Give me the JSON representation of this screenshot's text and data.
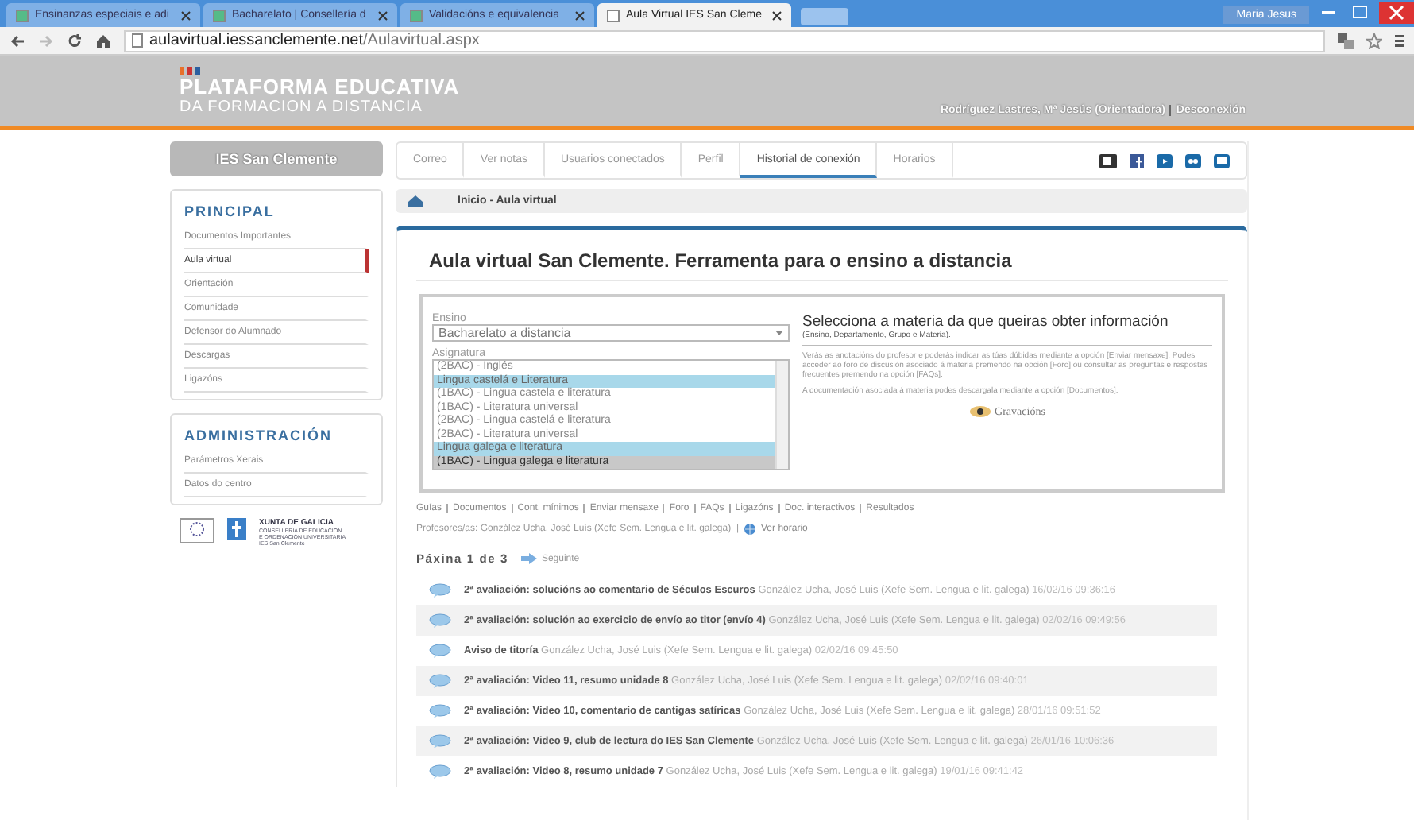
{
  "browser": {
    "tabs": [
      {
        "label": "Ensinanzas especiais e adi",
        "selected": false
      },
      {
        "label": "Bacharelato | Consellería d",
        "selected": false
      },
      {
        "label": "Validacións e equivalencia",
        "selected": false
      },
      {
        "label": "Aula Virtual IES San Cleme",
        "selected": true
      }
    ],
    "user": "Maria Jesus",
    "url_host": "aulavirtual.iessanclemente.net",
    "url_path": "/Aulavirtual.aspx"
  },
  "header": {
    "title": "PLATAFORMA EDUCATIVA",
    "subtitle": "DA FORMACION A DISTANCIA",
    "user": "Rodríguez Lastres, Mª Jesús (Orientadora)",
    "logout": "Desconexión"
  },
  "sidebar": {
    "school": "IES San Clemente",
    "sections": [
      {
        "title": "PRINCIPAL",
        "items": [
          {
            "label": "Documentos Importantes",
            "selected": false
          },
          {
            "label": "Aula virtual",
            "selected": true
          },
          {
            "label": "Orientación",
            "selected": false
          },
          {
            "label": "Comunidade",
            "selected": false
          },
          {
            "label": "Defensor do Alumnado",
            "selected": false
          },
          {
            "label": "Descargas",
            "selected": false
          },
          {
            "label": "Ligazóns",
            "selected": false
          }
        ]
      },
      {
        "title": "ADMINISTRACIÓN",
        "items": [
          {
            "label": "Parámetros Xerais",
            "selected": false
          },
          {
            "label": "Datos do centro",
            "selected": false
          }
        ]
      }
    ],
    "logo_title": "XUNTA DE GALICIA",
    "logo_lines": [
      "CONSELLERÍA DE EDUCACIÓN",
      "E ORDENACIÓN UNIVERSITARIA",
      "IES San Clemente"
    ]
  },
  "nav": {
    "tabs": [
      {
        "label": "Correo",
        "selected": false
      },
      {
        "label": "Ver notas",
        "selected": false
      },
      {
        "label": "Usuarios conectados",
        "selected": false
      },
      {
        "label": "Perfil",
        "selected": false
      },
      {
        "label": "Historial de conexión",
        "selected": true
      },
      {
        "label": "Horarios",
        "selected": false
      }
    ]
  },
  "breadcrumb": "Inicio  - Aula virtual",
  "page_title": "Aula virtual San Clemente. Ferramenta para o ensino a distancia",
  "form": {
    "ensino_label": "Ensino",
    "ensino_value": "Bacharelato a distancia",
    "asignatura_label": "Asignatura",
    "options": [
      {
        "kind": "option",
        "label": "(2BAC) - Inglés",
        "selected": false
      },
      {
        "kind": "group",
        "label": "Lingua castelá e Literatura",
        "selected": false
      },
      {
        "kind": "option",
        "label": "(1BAC) - Lingua castela e literatura",
        "selected": false
      },
      {
        "kind": "option",
        "label": "(1BAC) - Literatura universal",
        "selected": false
      },
      {
        "kind": "option",
        "label": "(2BAC) - Lingua castelá e literatura",
        "selected": false
      },
      {
        "kind": "option",
        "label": "(2BAC) - Literatura universal",
        "selected": false
      },
      {
        "kind": "group",
        "label": "Lingua galega e literatura",
        "selected": false
      },
      {
        "kind": "option",
        "label": "(1BAC) - Lingua galega e literatura",
        "selected": true
      }
    ]
  },
  "info": {
    "title": "Selecciona a materia da que queiras obter información",
    "subtitle": "(Ensino, Departamento, Grupo e Materia).",
    "paragraphs": [
      "Verás as anotacións do profesor e poderás indicar as túas dúbidas mediante a opción [Enviar mensaxe]. Podes acceder ao foro de discusión asociado á materia premendo na opción [Foro] ou consultar as preguntas e respostas frecuentes premendo na opción [FAQs].",
      "A documentación asociada á materia podes descargala mediante a opción [Documentos]."
    ],
    "recordings": "Gravacións"
  },
  "links": [
    "Guías",
    "Documentos",
    "Cont. mínimos",
    "Enviar mensaxe",
    "Foro",
    "FAQs",
    "Ligazóns",
    "Doc. interactivos",
    "Resultados"
  ],
  "teachers": "Profesores/as: González Ucha, José Luís (Xefe Sem. Lengua e lit. galega)  |",
  "schedule": "Ver horario",
  "pager": {
    "label": "Páxina 1 de 3",
    "next": "Seguinte"
  },
  "posts": [
    {
      "title": "2ª avaliación: solucións ao comentario de Séculos Escuros",
      "author": "González Ucha, José Luis (Xefe Sem. Lengua e lit. galega)",
      "date": "16/02/16 09:36:16"
    },
    {
      "title": "2ª avaliación: solución ao exercicio de envío ao titor (envío 4)",
      "author": "González Ucha, José Luis (Xefe Sem. Lengua e lit. galega)",
      "date": "02/02/16 09:49:56"
    },
    {
      "title": "Aviso de titoría",
      "author": "González Ucha, José Luis (Xefe Sem. Lengua e lit. galega)",
      "date": "02/02/16 09:45:50"
    },
    {
      "title": "2ª avaliación: Video 11, resumo unidade 8",
      "author": "González Ucha, José Luis (Xefe Sem. Lengua e lit. galega)",
      "date": "02/02/16 09:40:01"
    },
    {
      "title": "2ª avaliación: Video 10, comentario de cantigas satíricas",
      "author": "González Ucha, José Luis (Xefe Sem. Lengua e lit. galega)",
      "date": "28/01/16 09:51:52"
    },
    {
      "title": "2ª avaliación: Video 9, club de lectura do IES San Clemente",
      "author": "González Ucha, José Luis (Xefe Sem. Lengua e lit. galega)",
      "date": "26/01/16 10:06:36"
    },
    {
      "title": "2ª avaliación: Video 8, resumo unidade 7",
      "author": "González Ucha, José Luis (Xefe Sem. Lengua e lit. galega)",
      "date": "19/01/16 09:41:42"
    }
  ]
}
